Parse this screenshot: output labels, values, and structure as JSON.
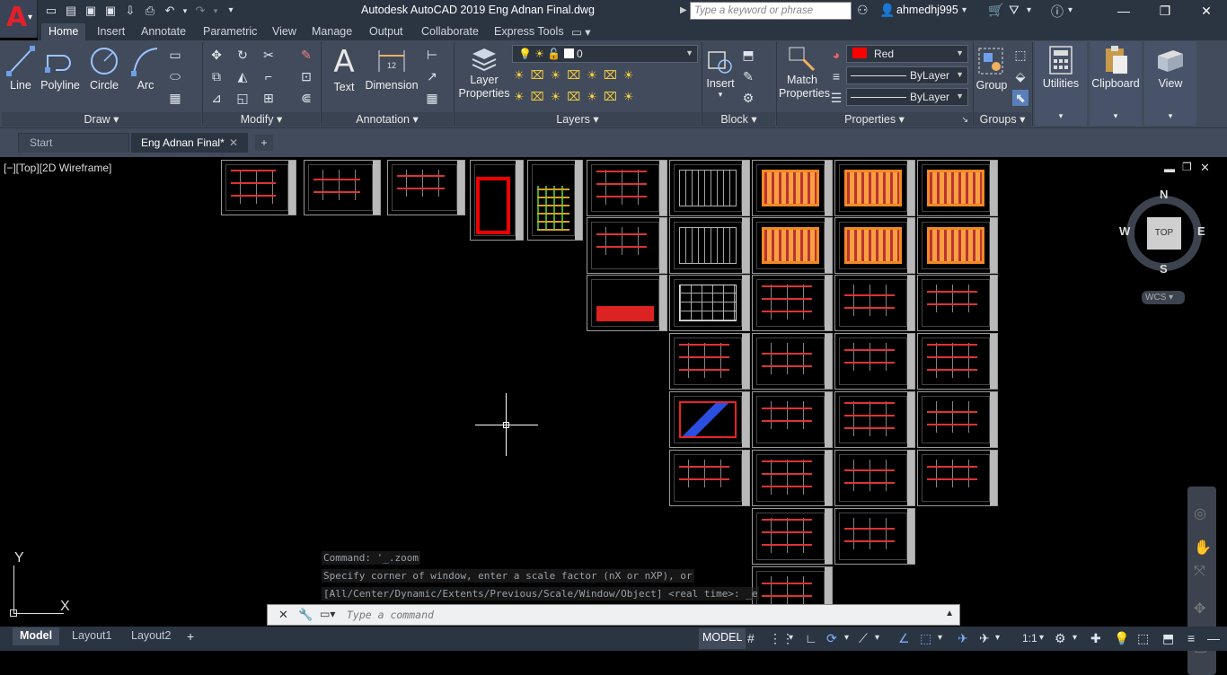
{
  "app": {
    "title": "Autodesk AutoCAD 2019    Eng Adnan Final.dwg",
    "search_placeholder": "Type a keyword or phrase",
    "username": "ahmedhj995",
    "logo_letter": "A"
  },
  "ribbon_tabs": [
    "Home",
    "Insert",
    "Annotate",
    "Parametric",
    "View",
    "Manage",
    "Output",
    "Collaborate",
    "Express Tools"
  ],
  "panels": {
    "draw": {
      "label": "Draw",
      "line": "Line",
      "polyline": "Polyline",
      "circle": "Circle",
      "arc": "Arc"
    },
    "modify": {
      "label": "Modify"
    },
    "annotation": {
      "label": "Annotation",
      "text": "Text",
      "dimension": "Dimension"
    },
    "layers": {
      "label": "Layers",
      "layer_properties_1": "Layer",
      "layer_properties_2": "Properties",
      "current_layer": "0"
    },
    "block": {
      "label": "Block",
      "insert": "Insert"
    },
    "properties": {
      "label": "Properties",
      "match_1": "Match",
      "match_2": "Properties",
      "color": "Red",
      "linetype": "ByLayer",
      "lineweight": "ByLayer"
    },
    "groups": {
      "label": "Groups",
      "group": "Group"
    },
    "utilities": {
      "label": "Utilities"
    },
    "clipboard": {
      "label": "Clipboard"
    },
    "view": {
      "label": "View"
    }
  },
  "file_tabs": {
    "start": "Start",
    "active": "Eng Adnan Final*"
  },
  "viewport": {
    "label": "[−][Top][2D Wireframe]"
  },
  "viewcube": {
    "n": "N",
    "s": "S",
    "e": "E",
    "w": "W",
    "top": "TOP",
    "wcs": "WCS"
  },
  "ucs": {
    "x": "X",
    "y": "Y"
  },
  "command": {
    "line1": "Command: '_.zoom",
    "line2": "Specify corner of window, enter a scale factor (nX or nXP), or",
    "line3": "[All/Center/Dynamic/Extents/Previous/Scale/Window/Object] <real time>: _e",
    "placeholder": "Type a command"
  },
  "layout_tabs": [
    "Model",
    "Layout1",
    "Layout2"
  ],
  "status": {
    "model": "MODEL",
    "scale": "1:1"
  },
  "colors": {
    "accent_red": "#e0202a",
    "ribbon_bg": "#414b5b",
    "title_bg": "#2b3441"
  }
}
